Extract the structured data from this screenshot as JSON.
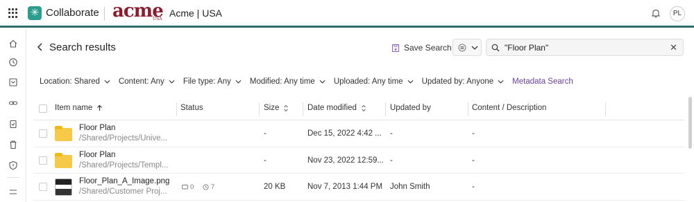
{
  "topbar": {
    "app_name": "Collaborate",
    "brand_logo_text": "acme",
    "brand_logo_sub": "USA",
    "org_name": "Acme | USA",
    "avatar_initials": "PL"
  },
  "rail": {
    "icons": [
      "home-icon",
      "recent-icon",
      "inbox-icon",
      "link-icon",
      "clipboard-icon",
      "trash-icon",
      "shield-icon",
      "settings-sliders-icon"
    ]
  },
  "header": {
    "title": "Search results",
    "save_search_label": "Save Search",
    "search_value": "\"Floor Plan\""
  },
  "filters": {
    "items": [
      {
        "label": "Location: Shared"
      },
      {
        "label": "Content: Any"
      },
      {
        "label": "File type: Any"
      },
      {
        "label": "Modified: Any time"
      },
      {
        "label": "Uploaded: Any time"
      },
      {
        "label": "Updated by: Anyone"
      }
    ],
    "metadata_link": "Metadata Search"
  },
  "table": {
    "columns": {
      "name": "Item name",
      "status": "Status",
      "size": "Size",
      "modified": "Date modified",
      "updated_by": "Updated by",
      "content": "Content / Description"
    },
    "rows": [
      {
        "type": "folder",
        "name": "Floor Plan",
        "path": "/Shared/Projects/Unive...",
        "status": "",
        "size": "-",
        "modified": "Dec 15, 2022 4:42 ...",
        "updated_by": "-",
        "content": "-"
      },
      {
        "type": "folder",
        "name": "Floor Plan",
        "path": "/Shared/Projects/Templ...",
        "status": "",
        "size": "-",
        "modified": "Nov 23, 2022 12:59...",
        "updated_by": "-",
        "content": "-"
      },
      {
        "type": "image",
        "name": "Floor_Plan_A_Image.png",
        "path": "/Shared/Customer Proj...",
        "comments": "0",
        "versions": "7",
        "size": "20 KB",
        "modified": "Nov 7, 2013 1:44 PM",
        "updated_by": "John Smith",
        "content": "-"
      }
    ]
  }
}
